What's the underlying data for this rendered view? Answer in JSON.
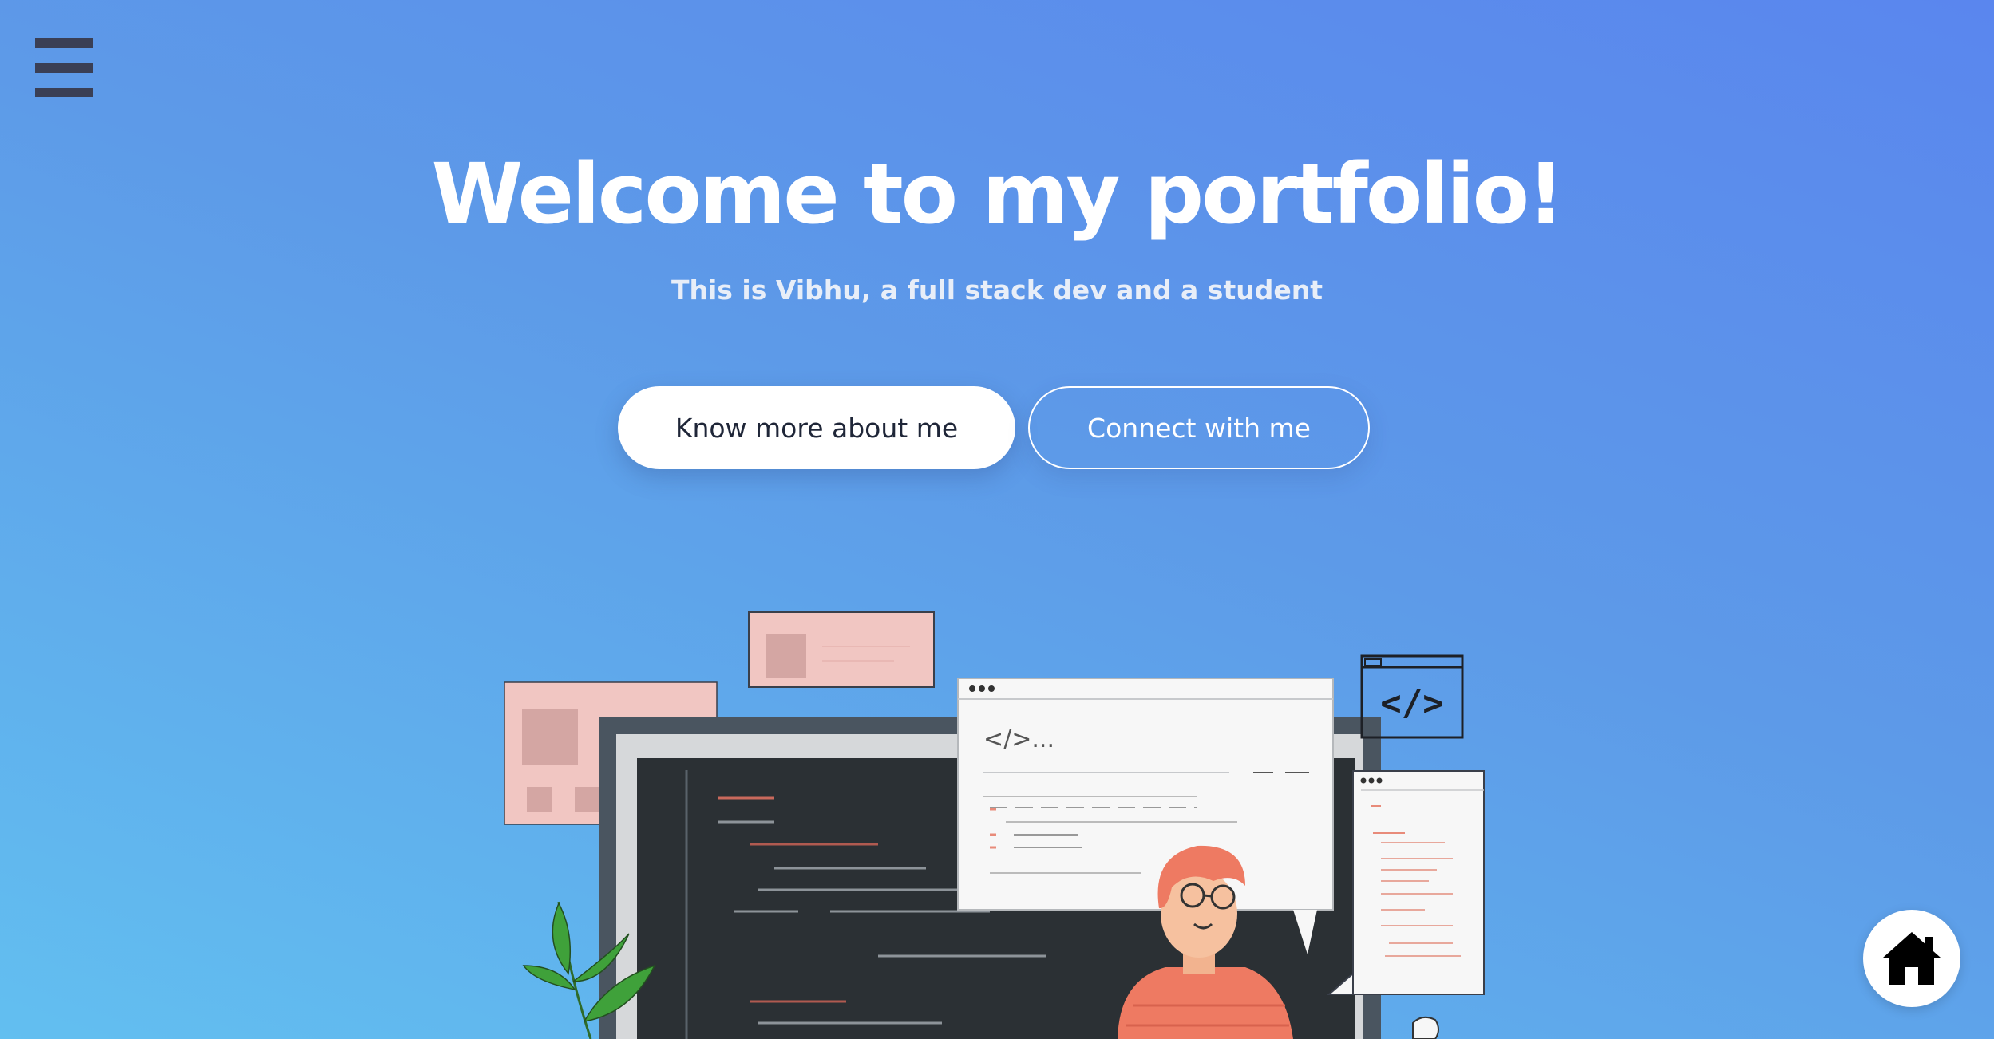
{
  "nav": {
    "menu_icon": "hamburger-menu-icon"
  },
  "hero": {
    "title": "Welcome to my portfolio!",
    "subtitle": "This is Vibhu, a full stack dev and a student"
  },
  "buttons": {
    "primary_label": "Know more about me",
    "secondary_label": "Connect with me"
  },
  "illustration": {
    "code_snippet": "</>...",
    "code_icon": "</>"
  },
  "home": {
    "icon": "home-icon"
  },
  "colors": {
    "background_top": "#5a86ee",
    "background_bottom": "#62bff0",
    "title": "#ffffff",
    "menu": "#3a3f55",
    "primary_button_text": "#1f2638"
  }
}
